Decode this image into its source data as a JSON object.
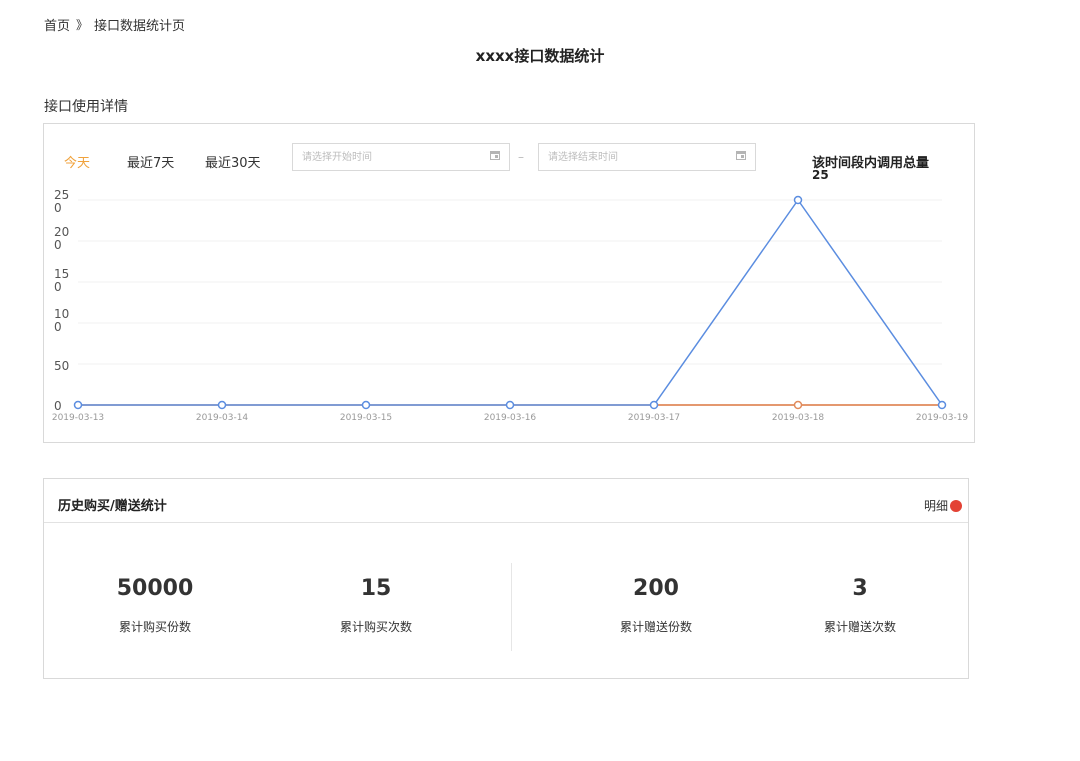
{
  "breadcrumb": {
    "home": "首页",
    "separator": "》",
    "current": "接口数据统计页"
  },
  "page_title": "xxxx接口数据统计",
  "section_label": "接口使用详情",
  "filters": {
    "tabs": [
      {
        "label": "今天",
        "active": true
      },
      {
        "label": "最近7天",
        "active": false
      },
      {
        "label": "最近30天",
        "active": false
      }
    ],
    "start_placeholder": "请选择开始时间",
    "end_placeholder": "请选择结束时间",
    "separator": "–"
  },
  "total": {
    "label": "该时间段内调用总量",
    "value": "25"
  },
  "chart_data": {
    "type": "line",
    "x": [
      "2019-03-13",
      "2019-03-14",
      "2019-03-15",
      "2019-03-16",
      "2019-03-17",
      "2019-03-18",
      "2019-03-19"
    ],
    "ylim": [
      0,
      250
    ],
    "yticks": [
      "250",
      "200",
      "150",
      "100",
      "50",
      "0"
    ],
    "grid": true,
    "series": [
      {
        "color": "#5b8de0",
        "values": [
          0,
          0,
          0,
          0,
          0,
          250,
          0
        ]
      },
      {
        "color": "#e08a5b",
        "values": [
          0,
          0,
          0,
          0,
          0,
          0,
          0
        ]
      }
    ]
  },
  "stats": {
    "title": "历史购买/赠送统计",
    "detail_label": "明细",
    "items": [
      {
        "value": "50000",
        "label": "累计购买份数"
      },
      {
        "value": "15",
        "label": "累计购买次数"
      },
      {
        "value": "200",
        "label": "累计赠送份数"
      },
      {
        "value": "3",
        "label": "累计赠送次数"
      }
    ]
  },
  "colors": {
    "accent": "#f0a23c",
    "line_primary": "#5b8de0",
    "line_secondary": "#e08a5b",
    "badge": "#e34234"
  }
}
